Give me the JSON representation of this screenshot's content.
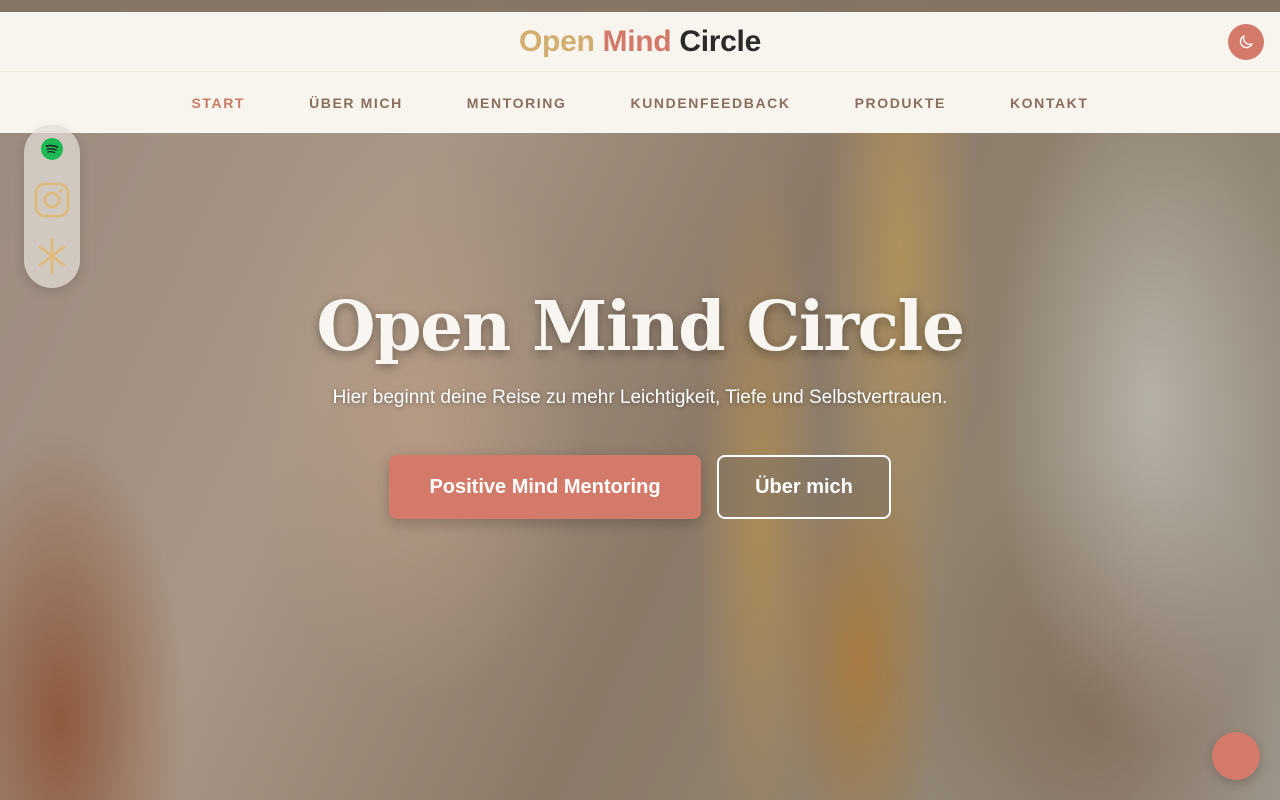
{
  "header": {
    "logo": {
      "word1": "Open",
      "word2": "Mind",
      "word3": "Circle"
    },
    "theme_toggle_icon": "moon-icon"
  },
  "nav": {
    "items": [
      {
        "label": "START",
        "active": true
      },
      {
        "label": "ÜBER MICH",
        "active": false
      },
      {
        "label": "MENTORING",
        "active": false
      },
      {
        "label": "KUNDENFEEDBACK",
        "active": false
      },
      {
        "label": "PRODUKTE",
        "active": false
      },
      {
        "label": "KONTAKT",
        "active": false
      }
    ]
  },
  "social": {
    "icons": [
      "spotify-icon",
      "instagram-icon",
      "asterisk-icon"
    ]
  },
  "hero": {
    "title": "Open Mind Circle",
    "subtitle": "Hier beginnt deine Reise zu mehr Leichtigkeit, Tiefe und Selbstvertrauen.",
    "primary_button": "Positive Mind Mentoring",
    "secondary_button": "Über mich"
  },
  "colors": {
    "accent": "#d47a6a",
    "gold": "#d4ad70",
    "header_bg": "#f8f5ef",
    "nav_text": "#8a6e5e"
  }
}
